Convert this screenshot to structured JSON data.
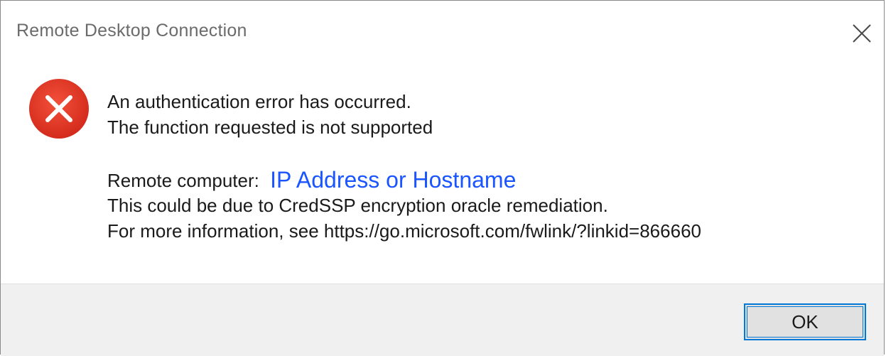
{
  "window": {
    "title": "Remote Desktop Connection",
    "close_icon": "close-icon"
  },
  "dialog": {
    "icon": "error-icon",
    "icon_color": "#e81123",
    "message_line1": "An authentication error has occurred.",
    "message_line2": "The function requested is not supported",
    "remote_label": "Remote computer:",
    "remote_value": "IP Address or Hostname",
    "remote_value_color": "#1a55ff",
    "detail_line1": "This could be due to CredSSP encryption oracle remediation.",
    "detail_line2": "For more information, see https://go.microsoft.com/fwlink/?linkid=866660"
  },
  "footer": {
    "ok_label": "OK",
    "accent": "#0078d7"
  }
}
